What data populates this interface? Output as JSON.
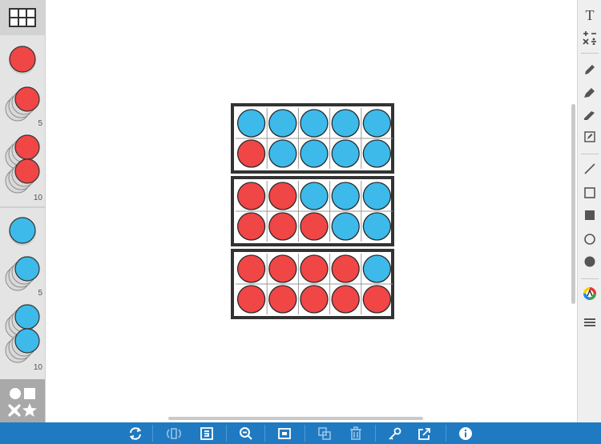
{
  "colors": {
    "red_counter": "#f04646",
    "blue_counter": "#3dbaea",
    "frame_border": "#333333",
    "bottom_bar": "#1f7ac2"
  },
  "left_palette": {
    "tools": [
      {
        "name": "ten-frame-tool",
        "icon": "grid-icon"
      },
      {
        "name": "red-counter",
        "icon": "red-circle"
      },
      {
        "name": "red-counter-stack-5",
        "count_label": "5"
      },
      {
        "name": "red-counter-stack-10",
        "count_label": "10"
      },
      {
        "name": "blue-counter",
        "icon": "blue-circle"
      },
      {
        "name": "blue-counter-stack-5",
        "count_label": "5"
      },
      {
        "name": "blue-counter-stack-10",
        "count_label": "10"
      },
      {
        "name": "shapes-tool",
        "icon": "shapes-icon"
      }
    ]
  },
  "ten_frames": [
    {
      "rows": [
        [
          "blue",
          "blue",
          "blue",
          "blue",
          "blue"
        ],
        [
          "red",
          "blue",
          "blue",
          "blue",
          "blue"
        ]
      ]
    },
    {
      "rows": [
        [
          "red",
          "red",
          "blue",
          "blue",
          "blue"
        ],
        [
          "red",
          "red",
          "red",
          "blue",
          "blue"
        ]
      ]
    },
    {
      "rows": [
        [
          "red",
          "red",
          "red",
          "red",
          "blue"
        ],
        [
          "red",
          "red",
          "red",
          "red",
          "red"
        ]
      ]
    }
  ],
  "right_toolbar": {
    "text_tool": "T",
    "tools": [
      "text-icon",
      "math-symbols-icon",
      "pen-icon",
      "marker-icon",
      "highlighter-icon",
      "edit-box-icon",
      "line-icon",
      "rectangle-outline-icon",
      "rectangle-filled-icon",
      "circle-outline-icon",
      "circle-filled-icon",
      "color-picker-icon",
      "menu-icon"
    ]
  },
  "bottom_toolbar": {
    "tools": [
      "refresh-icon",
      "rotate-icon",
      "fit-icon",
      "zoom-out-icon",
      "layers-icon",
      "duplicate-icon",
      "trash-icon",
      "key-icon",
      "share-icon",
      "info-icon"
    ]
  }
}
